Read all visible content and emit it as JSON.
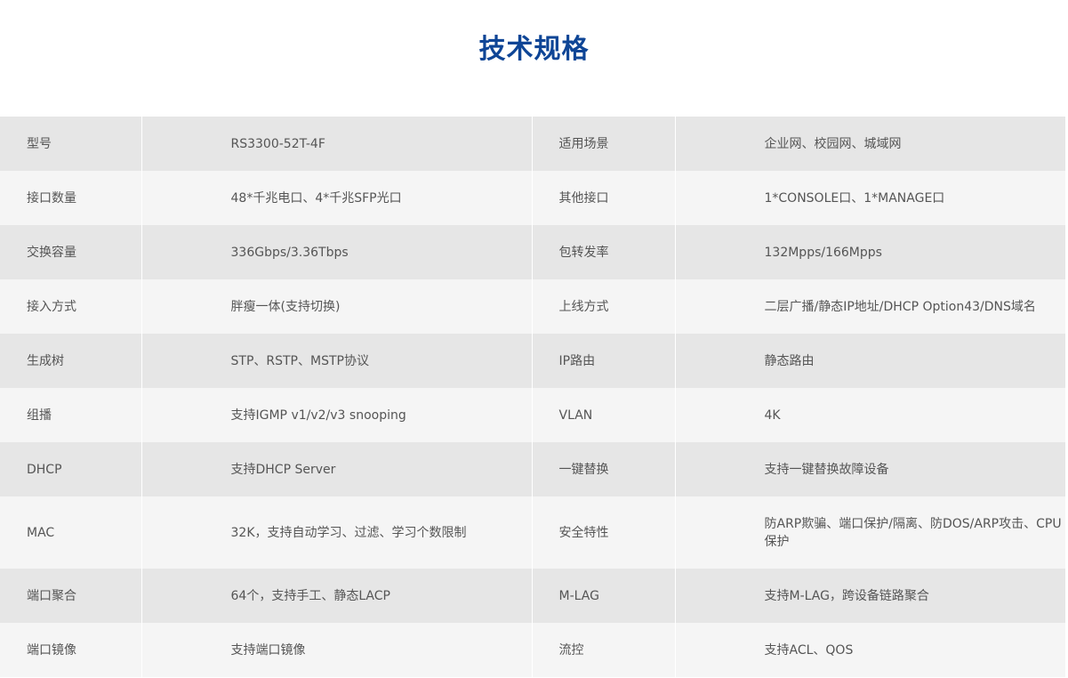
{
  "title": "技术规格",
  "rows": [
    {
      "k1": "型号",
      "v1": "RS3300-52T-4F",
      "k2": "适用场景",
      "v2": "企业网、校园网、城域网"
    },
    {
      "k1": "接口数量",
      "v1": "48*千兆电口、4*千兆SFP光口",
      "k2": "其他接口",
      "v2": "1*CONSOLE口、1*MANAGE口"
    },
    {
      "k1": "交换容量",
      "v1": "336Gbps/3.36Tbps",
      "k2": "包转发率",
      "v2": "132Mpps/166Mpps"
    },
    {
      "k1": "接入方式",
      "v1": "胖瘦一体(支持切换)",
      "k2": "上线方式",
      "v2": "二层广播/静态IP地址/DHCP Option43/DNS域名"
    },
    {
      "k1": "生成树",
      "v1": "STP、RSTP、MSTP协议",
      "k2": "IP路由",
      "v2": "静态路由"
    },
    {
      "k1": "组播",
      "v1": "支持IGMP v1/v2/v3 snooping",
      "k2": "VLAN",
      "v2": "4K"
    },
    {
      "k1": "DHCP",
      "v1": "支持DHCP Server",
      "k2": "一键替换",
      "v2": "支持一键替换故障设备"
    },
    {
      "k1": "MAC",
      "v1": "32K，支持自动学习、过滤、学习个数限制",
      "k2": "安全特性",
      "v2": "防ARP欺骗、端口保护/隔离、防DOS/ARP攻击、CPU保护"
    },
    {
      "k1": "端口聚合",
      "v1": "64个，支持手工、静态LACP",
      "k2": "M-LAG",
      "v2": "支持M-LAG，跨设备链路聚合"
    },
    {
      "k1": "端口镜像",
      "v1": "支持端口镜像",
      "k2": "流控",
      "v2": "支持ACL、QOS"
    }
  ]
}
